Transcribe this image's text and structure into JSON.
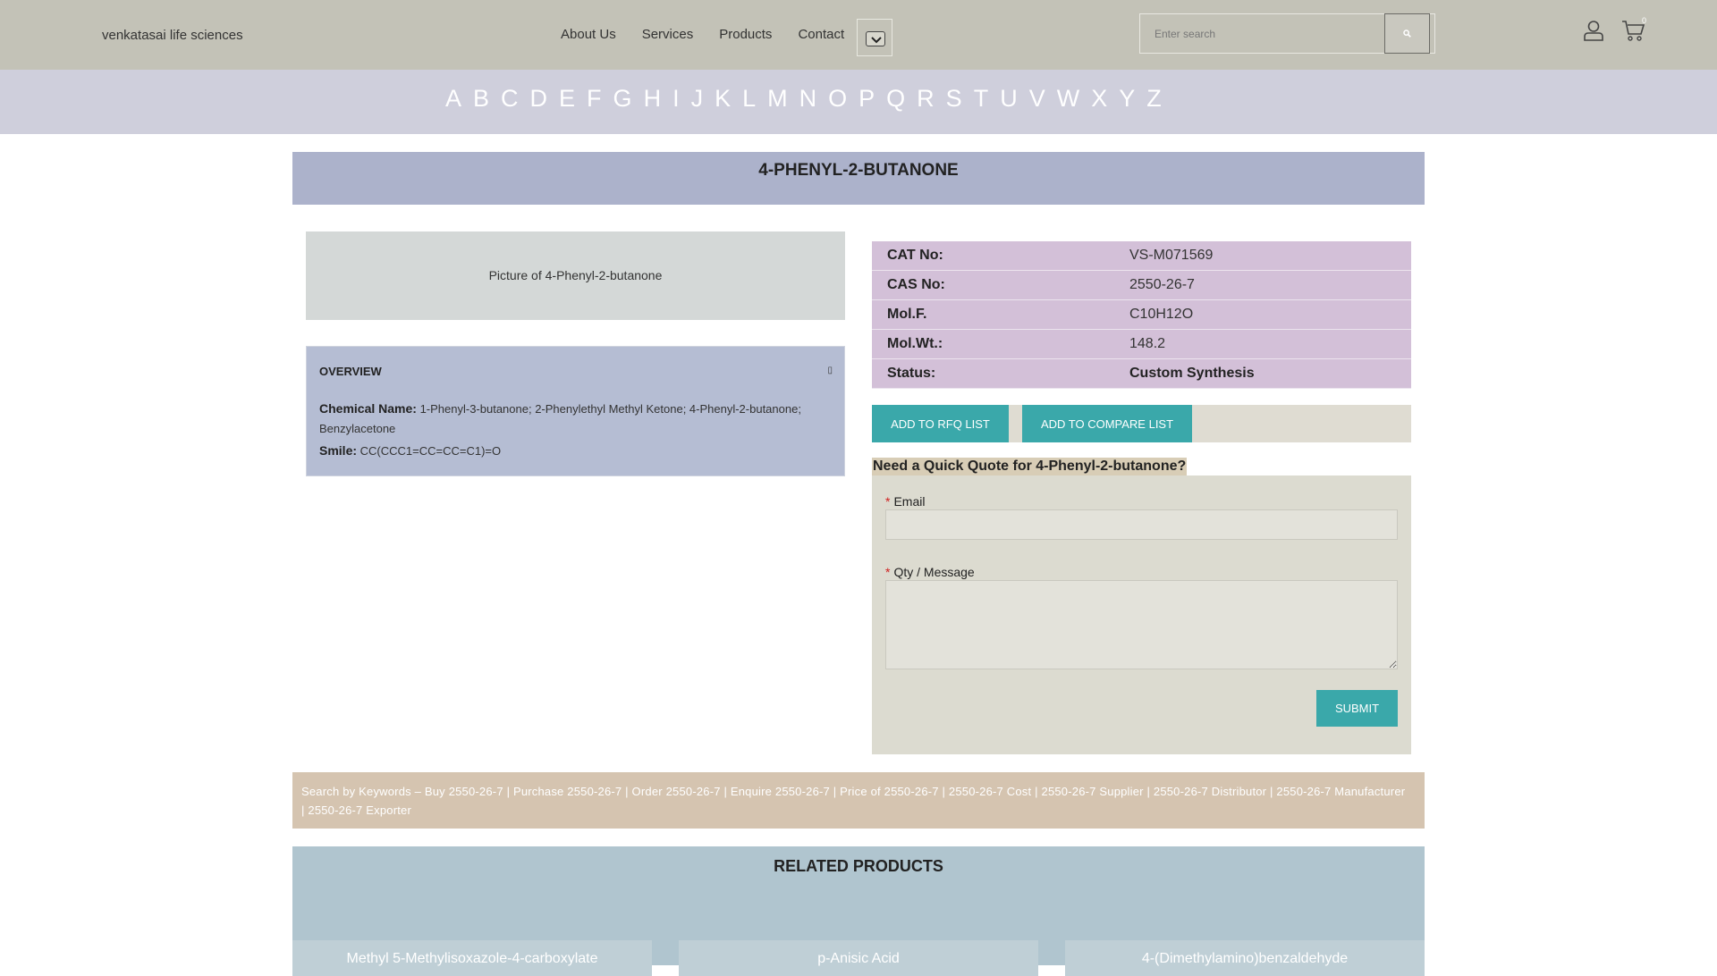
{
  "header": {
    "logo_alt": "venkatasai life sciences",
    "nav": [
      "About Us",
      "Services",
      "Products",
      "Contact"
    ],
    "search_placeholder": "Enter search",
    "cart_count": "0"
  },
  "alphabet": [
    "A",
    "B",
    "C",
    "D",
    "E",
    "F",
    "G",
    "H",
    "I",
    "J",
    "K",
    "L",
    "M",
    "N",
    "O",
    "P",
    "Q",
    "R",
    "S",
    "T",
    "U",
    "V",
    "W",
    "X",
    "Y",
    "Z"
  ],
  "product": {
    "title": "4-PHENYL-2-BUTANONE",
    "image_alt": "Picture of 4-Phenyl-2-butanone"
  },
  "overview": {
    "heading": "OVERVIEW",
    "chemical_name_label": "Chemical Name:",
    "chemical_name": "1-Phenyl-3-butanone; 2-Phenylethyl Methyl Ketone; 4-Phenyl-2-butanone; Benzylacetone",
    "smile_label": "Smile:",
    "smile": "CC(CCC1=CC=CC=C1)=O"
  },
  "spec": [
    {
      "label": "CAT No:",
      "value": "VS-M071569"
    },
    {
      "label": "CAS No:",
      "value": "2550-26-7"
    },
    {
      "label": "Mol.F.",
      "value": "C10H12O"
    },
    {
      "label": "Mol.Wt.:",
      "value": "148.2"
    },
    {
      "label": "Status:",
      "value": "Custom Synthesis"
    }
  ],
  "actions": {
    "rfq": "ADD TO RFQ LIST",
    "compare": "ADD TO COMPARE LIST"
  },
  "quote": {
    "title": "Need a Quick Quote for 4-Phenyl-2-butanone?",
    "email_label": "Email",
    "message_label": "Qty / Message",
    "required_mark": "*",
    "submit": "SUBMIT"
  },
  "keywords": "Search by Keywords – Buy 2550-26-7 | Purchase 2550-26-7 | Order 2550-26-7 | Enquire 2550-26-7 | Price of 2550-26-7 | 2550-26-7 Cost | 2550-26-7 Supplier | 2550-26-7 Distributor | 2550-26-7 Manufacturer | 2550-26-7 Exporter",
  "related": {
    "heading": "RELATED PRODUCTS",
    "items": [
      "Methyl 5-Methylisoxazole-4-carboxylate",
      "p-Anisic Acid",
      "4-(Dimethylamino)benzaldehyde"
    ]
  }
}
